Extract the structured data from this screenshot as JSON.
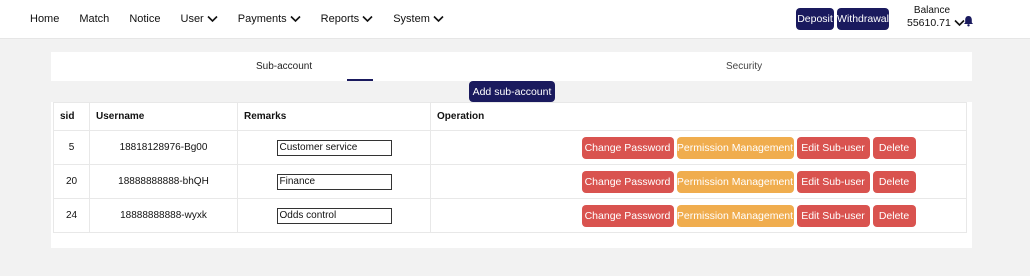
{
  "nav": {
    "home": "Home",
    "match": "Match",
    "notice": "Notice",
    "user": "User",
    "payments": "Payments",
    "reports": "Reports",
    "system": "System"
  },
  "header": {
    "deposit": "Deposit",
    "withdrawal": "Withdrawal",
    "balance_label": "Balance",
    "balance_value": "55610.71"
  },
  "tabs": {
    "sub_account": "Sub-account",
    "security": "Security"
  },
  "add_button": "Add sub-account",
  "table": {
    "headers": [
      "sid",
      "Username",
      "Remarks",
      "Operation"
    ],
    "rows": [
      {
        "sid": "5",
        "username": "18818128976-Bg00",
        "remarks": "Customer service"
      },
      {
        "sid": "20",
        "username": "18888888888-bhQH",
        "remarks": "Finance"
      },
      {
        "sid": "24",
        "username": "18888888888-wyxk",
        "remarks": "Odds control"
      }
    ],
    "ops": {
      "change_password": "Change Password",
      "permission": "Permission Management",
      "edit": "Edit Sub-user",
      "delete": "Delete"
    }
  },
  "colors": {
    "brand": "#1a1a5e",
    "danger": "#d9534f",
    "warning": "#f0ad4e"
  },
  "icons": {
    "dropdown": "chevron-down-icon",
    "bell": "bell-icon"
  }
}
